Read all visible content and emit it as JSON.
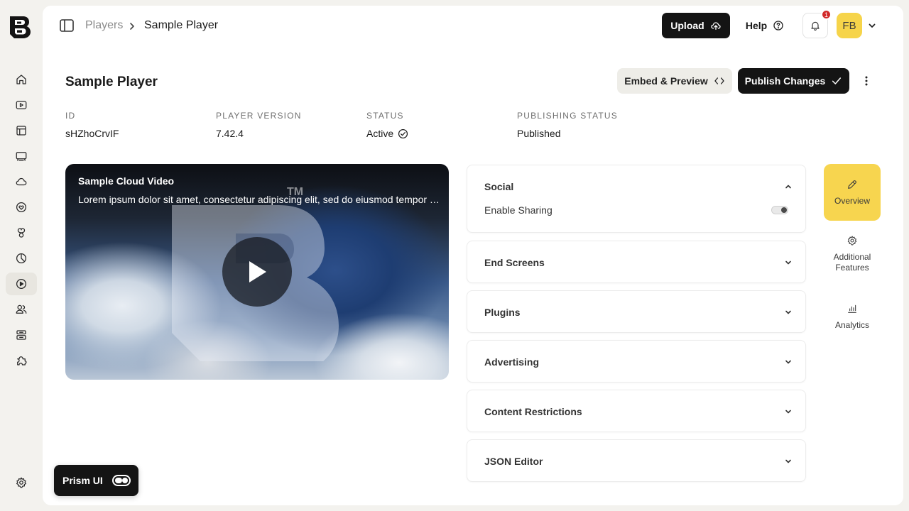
{
  "app": {
    "logo_icon": "bold-b-logo",
    "rail_items": [
      {
        "name": "home",
        "icon": "home-icon"
      },
      {
        "name": "videos",
        "icon": "video-icon"
      },
      {
        "name": "playlists",
        "icon": "layout-icon"
      },
      {
        "name": "live",
        "icon": "monitor-icon"
      },
      {
        "name": "cloud",
        "icon": "cloud-icon"
      },
      {
        "name": "engagement",
        "icon": "heart-icon"
      },
      {
        "name": "templates",
        "icon": "clover-icon"
      },
      {
        "name": "analytics",
        "icon": "pie-icon"
      },
      {
        "name": "players",
        "icon": "play-circle-icon",
        "active": true
      },
      {
        "name": "users",
        "icon": "users-icon"
      },
      {
        "name": "storage",
        "icon": "archive-icon"
      },
      {
        "name": "integrations",
        "icon": "puzzle-icon"
      }
    ],
    "settings_icon": "gear-icon"
  },
  "topbar": {
    "breadcrumb": [
      "Players",
      "Sample Player"
    ],
    "upload_label": "Upload",
    "help_label": "Help",
    "notification_count": "1",
    "avatar_initials": "FB"
  },
  "page": {
    "title": "Sample Player",
    "embed_label": "Embed & Preview",
    "publish_label": "Publish Changes",
    "meta": [
      {
        "label": "ID",
        "value": "sHZhoCrvIF"
      },
      {
        "label": "PLAYER VERSION",
        "value": "7.42.4"
      },
      {
        "label": "STATUS",
        "value": "Active"
      },
      {
        "label": "PUBLISHING STATUS",
        "value": "Published"
      }
    ]
  },
  "video": {
    "title": "Sample Cloud Video",
    "description": "Lorem ipsum dolor sit amet, consectetur adipiscing elit, sed do eiusmod tempor incididunt ut labore et dolore magna aliqua.",
    "watermark_tm": "TM"
  },
  "accordion": {
    "social": {
      "title": "Social",
      "expanded": true,
      "option_label": "Enable Sharing",
      "option_enabled": false
    },
    "sections": [
      "End Screens",
      "Plugins",
      "Advertising",
      "Content Restrictions",
      "JSON Editor"
    ]
  },
  "side_tabs": [
    {
      "label": "Overview",
      "icon": "pencil-icon",
      "active": true
    },
    {
      "label": "Additional Features",
      "icon": "gear-icon"
    },
    {
      "label": "Analytics",
      "icon": "bar-chart-icon"
    }
  ],
  "prism": {
    "label": "Prism UI",
    "enabled": true
  },
  "colors": {
    "accent": "#f6d44a",
    "dark": "#141414",
    "background": "#f3f2ee"
  }
}
